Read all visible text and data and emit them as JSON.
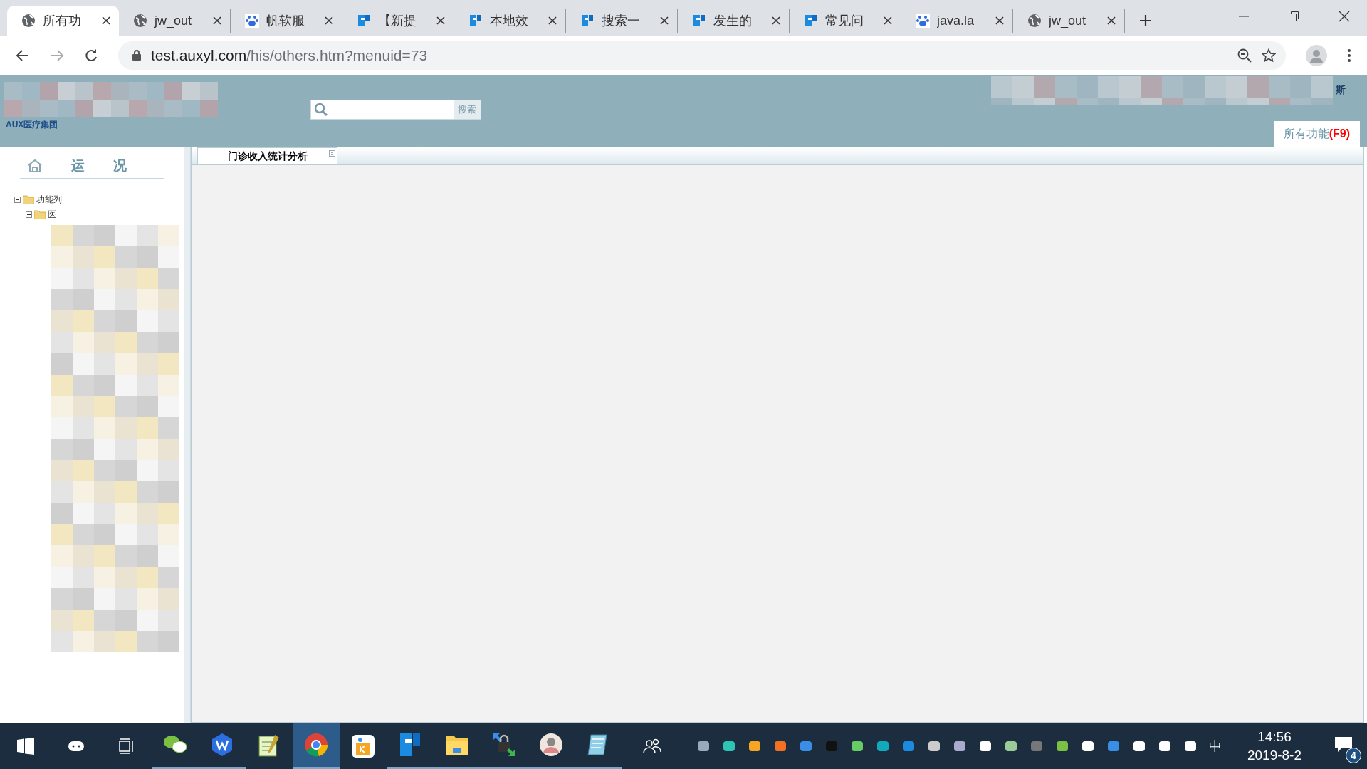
{
  "browser": {
    "tabs": [
      {
        "label": "所有功",
        "kind": "globe",
        "selected": true
      },
      {
        "label": "jw_out",
        "kind": "globe",
        "selected": false
      },
      {
        "label": "帆软服",
        "kind": "paw",
        "selected": false
      },
      {
        "label": "【新提",
        "kind": "f",
        "selected": false
      },
      {
        "label": "本地效",
        "kind": "f",
        "selected": false
      },
      {
        "label": "搜索一",
        "kind": "f",
        "selected": false
      },
      {
        "label": "发生的",
        "kind": "f",
        "selected": false
      },
      {
        "label": "常见问",
        "kind": "f",
        "selected": false
      },
      {
        "label": "java.la",
        "kind": "paw",
        "selected": false
      },
      {
        "label": "jw_out",
        "kind": "globe",
        "selected": false
      }
    ],
    "address": {
      "host": "test.auxyl.com",
      "path": "/his/others.htm?menuid=73"
    }
  },
  "header": {
    "logo": "AUX医疗集团",
    "search": {
      "button": "搜索"
    },
    "brand_fragment": "斯",
    "all_functions": {
      "label": "所有功能",
      "shortcut": "(F9)"
    }
  },
  "sidebar": {
    "title_parts": [
      "运",
      "况"
    ],
    "tree": [
      {
        "label": "功能列",
        "expanded": true,
        "children": [
          {
            "label": "医",
            "expanded": true
          }
        ]
      }
    ]
  },
  "content": {
    "tabs": [
      {
        "label": "门诊收入统计分析",
        "selected": true
      }
    ]
  },
  "taskbar": {
    "apps": [
      {
        "kind": "wechat",
        "running": true,
        "selected": false
      },
      {
        "kind": "wps",
        "running": true,
        "selected": false
      },
      {
        "kind": "notepadpp",
        "running": false,
        "selected": false
      },
      {
        "kind": "chrome",
        "running": true,
        "selected": true
      },
      {
        "kind": "music",
        "running": false,
        "selected": false
      },
      {
        "kind": "f",
        "running": true,
        "selected": false
      },
      {
        "kind": "folder",
        "running": true,
        "selected": false
      },
      {
        "kind": "lock",
        "running": true,
        "selected": false
      },
      {
        "kind": "avatar",
        "running": true,
        "selected": false
      },
      {
        "kind": "notepad",
        "running": true,
        "selected": false
      }
    ],
    "ime": "中",
    "time": "14:56",
    "date": "2019-8-2",
    "notifications": "4"
  }
}
